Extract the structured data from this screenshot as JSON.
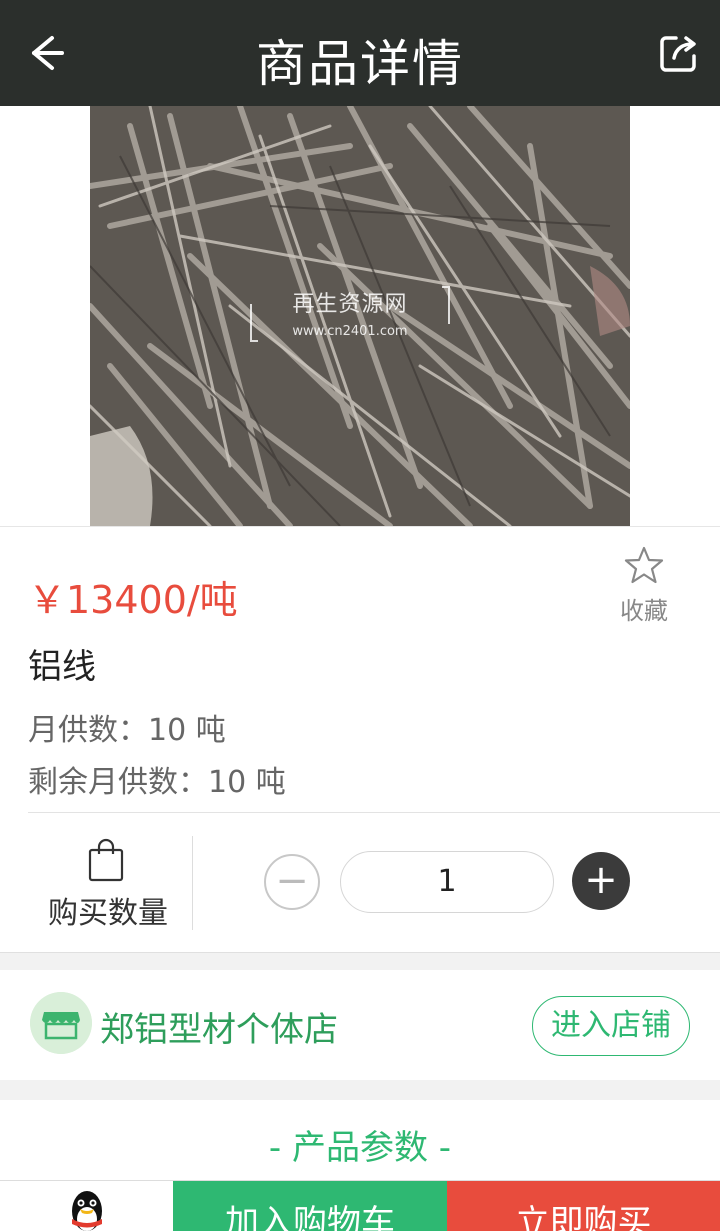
{
  "header": {
    "title": "商品详情",
    "back_icon": "arrow-left-icon",
    "share_icon": "share-icon"
  },
  "gallery": {
    "watermark_title": "再生资源网",
    "watermark_url": "www.cn2401.com",
    "slide_count": 2,
    "active_slide": 1,
    "active_dot_color": "#2eb872"
  },
  "product": {
    "price": "￥13400/吨",
    "favorite_label": "收藏",
    "name": "铝线",
    "monthly_supply": "月供数：10 吨",
    "remaining_supply": "剩余月供数：10 吨"
  },
  "quantity": {
    "label": "购买数量",
    "value": "1",
    "minus_label": "−",
    "plus_label": "+"
  },
  "store": {
    "name": "郑铝型材个体店",
    "enter_label": "进入店铺"
  },
  "params": {
    "title": "- 产品参数 -"
  },
  "bottom_bar": {
    "add_to_cart": "加入购物车",
    "buy_now": "立即购买",
    "cart_color": "#2eb872",
    "buy_color": "#e84c3d"
  }
}
